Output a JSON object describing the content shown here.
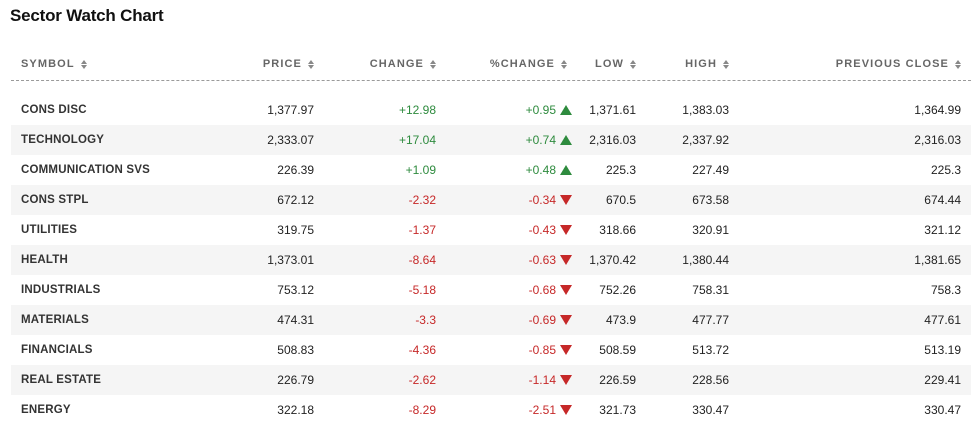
{
  "title": "Sector Watch Chart",
  "columns": {
    "symbol": "SYMBOL",
    "price": "PRICE",
    "change": "CHANGE",
    "pct_change": "%CHANGE",
    "low": "LOW",
    "high": "HIGH",
    "previous_close": "PREVIOUS CLOSE"
  },
  "colors": {
    "positive": "#2e8b3e",
    "negative": "#c62828"
  },
  "rows": [
    {
      "symbol": "CONS DISC",
      "price": "1,377.97",
      "change": "+12.98",
      "pct_change": "+0.95",
      "direction": "up",
      "low": "1,371.61",
      "high": "1,383.03",
      "previous_close": "1,364.99"
    },
    {
      "symbol": "TECHNOLOGY",
      "price": "2,333.07",
      "change": "+17.04",
      "pct_change": "+0.74",
      "direction": "up",
      "low": "2,316.03",
      "high": "2,337.92",
      "previous_close": "2,316.03"
    },
    {
      "symbol": "COMMUNICATION SVS",
      "price": "226.39",
      "change": "+1.09",
      "pct_change": "+0.48",
      "direction": "up",
      "low": "225.3",
      "high": "227.49",
      "previous_close": "225.3"
    },
    {
      "symbol": "CONS STPL",
      "price": "672.12",
      "change": "-2.32",
      "pct_change": "-0.34",
      "direction": "down",
      "low": "670.5",
      "high": "673.58",
      "previous_close": "674.44"
    },
    {
      "symbol": "UTILITIES",
      "price": "319.75",
      "change": "-1.37",
      "pct_change": "-0.43",
      "direction": "down",
      "low": "318.66",
      "high": "320.91",
      "previous_close": "321.12"
    },
    {
      "symbol": "HEALTH",
      "price": "1,373.01",
      "change": "-8.64",
      "pct_change": "-0.63",
      "direction": "down",
      "low": "1,370.42",
      "high": "1,380.44",
      "previous_close": "1,381.65"
    },
    {
      "symbol": "INDUSTRIALS",
      "price": "753.12",
      "change": "-5.18",
      "pct_change": "-0.68",
      "direction": "down",
      "low": "752.26",
      "high": "758.31",
      "previous_close": "758.3"
    },
    {
      "symbol": "MATERIALS",
      "price": "474.31",
      "change": "-3.3",
      "pct_change": "-0.69",
      "direction": "down",
      "low": "473.9",
      "high": "477.77",
      "previous_close": "477.61"
    },
    {
      "symbol": "FINANCIALS",
      "price": "508.83",
      "change": "-4.36",
      "pct_change": "-0.85",
      "direction": "down",
      "low": "508.59",
      "high": "513.72",
      "previous_close": "513.19"
    },
    {
      "symbol": "REAL ESTATE",
      "price": "226.79",
      "change": "-2.62",
      "pct_change": "-1.14",
      "direction": "down",
      "low": "226.59",
      "high": "228.56",
      "previous_close": "229.41"
    },
    {
      "symbol": "ENERGY",
      "price": "322.18",
      "change": "-8.29",
      "pct_change": "-2.51",
      "direction": "down",
      "low": "321.73",
      "high": "330.47",
      "previous_close": "330.47"
    }
  ]
}
